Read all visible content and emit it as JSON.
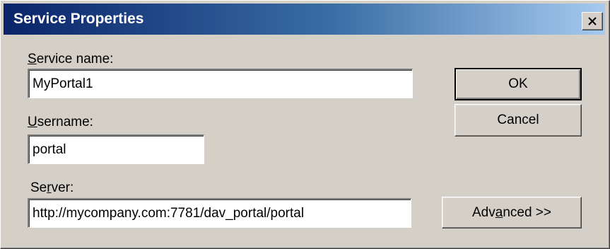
{
  "window": {
    "title": "Service Properties",
    "close_label": "close"
  },
  "fields": {
    "service_name": {
      "label_mnemonic": "S",
      "label_rest": "ervice name:",
      "value": "MyPortal1"
    },
    "username": {
      "label_mnemonic": "U",
      "label_rest": "sername:",
      "value": "portal"
    },
    "server": {
      "label_prefix": "Se",
      "label_mnemonic": "r",
      "label_rest": "ver:",
      "value": "http://mycompany.com:7781/dav_portal/portal"
    }
  },
  "buttons": {
    "ok": "OK",
    "cancel": "Cancel",
    "advanced_prefix": "Adv",
    "advanced_mnemonic": "a",
    "advanced_rest": "nced >>"
  },
  "colors": {
    "dialog_face": "#d4d0c8",
    "titlebar_start": "#0a246a",
    "titlebar_end": "#a6caf0",
    "title_text": "#ffffff"
  },
  "icons": {
    "close": "close-icon"
  }
}
